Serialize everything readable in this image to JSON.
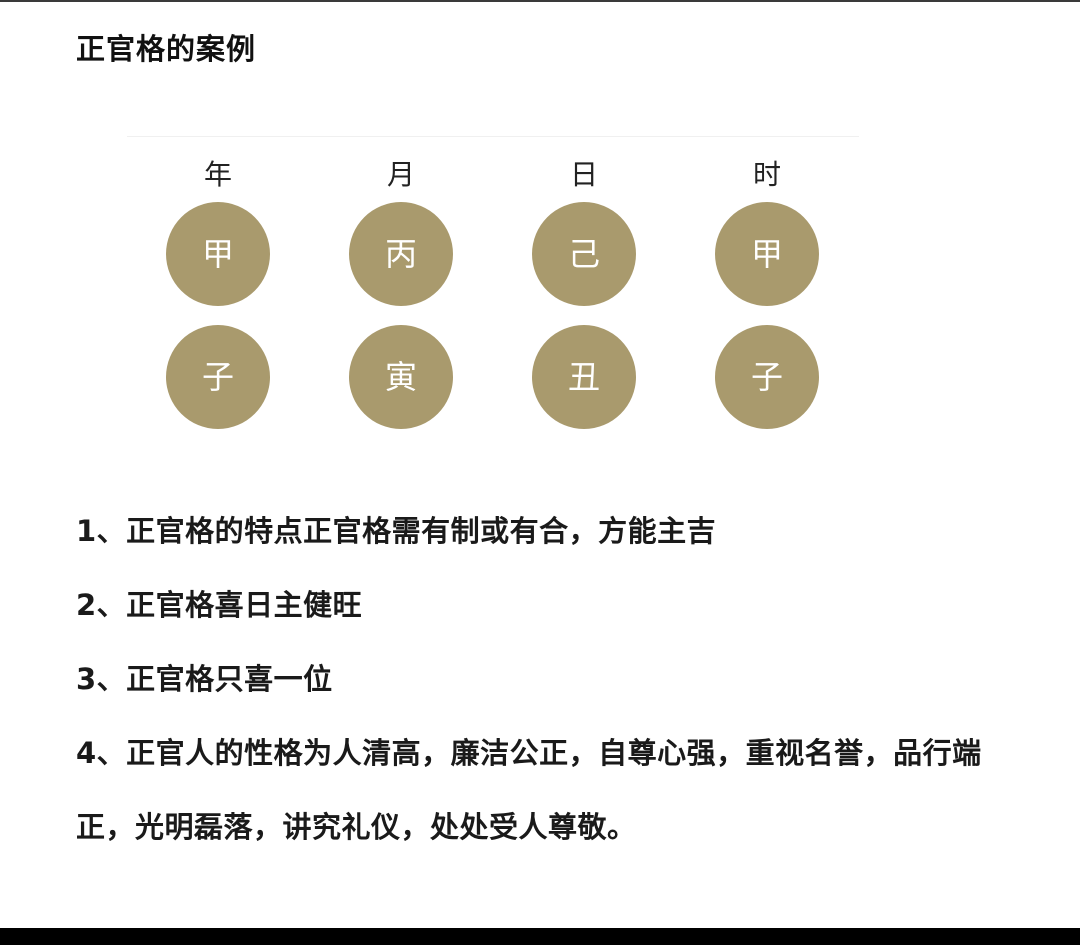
{
  "page": {
    "title": "正官格的案例"
  },
  "chart": {
    "circle_color": "#a99a6d",
    "pillars": [
      {
        "label": "年",
        "stem": "甲",
        "branch": "子"
      },
      {
        "label": "月",
        "stem": "丙",
        "branch": "寅"
      },
      {
        "label": "日",
        "stem": "己",
        "branch": "丑"
      },
      {
        "label": "时",
        "stem": "甲",
        "branch": "子"
      }
    ]
  },
  "notes": [
    "1、正官格的特点正官格需有制或有合，方能主吉",
    "2、正官格喜日主健旺",
    "3、正官格只喜一位",
    "4、正官人的性格为人清高，廉洁公正，自尊心强，重视名誉，品行端",
    "正，光明磊落，讲究礼仪，处处受人尊敬。"
  ]
}
